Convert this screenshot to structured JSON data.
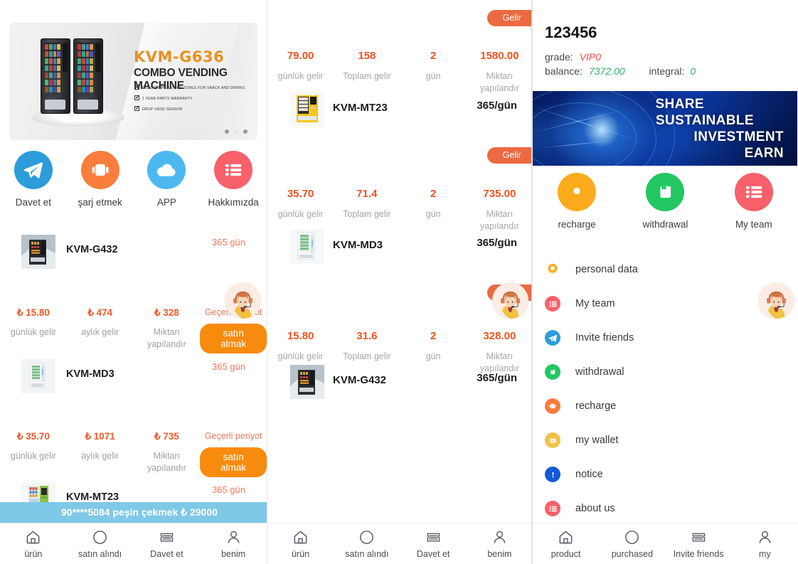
{
  "colors": {
    "orange": "#f05a28",
    "orange_badge": "#ec6941",
    "buy_button": "#f78b0e",
    "blue_notice": "#7ec8e8",
    "vip_red": "#fb4a45",
    "balance_green": "#28b463",
    "days_red": "#f0775a"
  },
  "left_panel": {
    "carousel": {
      "model": "KVM-G636",
      "title": "COMBO VENDING MACHINE",
      "features": [
        "DUAL TEMPERATURE ZONES FOR SNACK AND DRINKS",
        "1 YEAR PARTS WARRANTY",
        "DROP VEND SENSOR"
      ],
      "dots": 3,
      "active_dot": 1
    },
    "quick_actions": [
      {
        "label": "Davet et",
        "icon": "telegram-plane-icon",
        "color": "#2d9cdb"
      },
      {
        "label": "şarj etmek",
        "icon": "recharge-icon",
        "color": "#f97d3c"
      },
      {
        "label": "APP",
        "icon": "cloud-icon",
        "color": "#4db8f0"
      },
      {
        "label": "Hakkımızda",
        "icon": "list-icon",
        "color": "#f8606a"
      }
    ],
    "products": [
      {
        "name": "KVM-G432",
        "days": "365 gün",
        "thumb": "vending-machine-dark",
        "stats": [
          {
            "value": "₺ 15.80",
            "label": "günlük gelir"
          },
          {
            "value": "₺ 474",
            "label": "aylık gelir"
          },
          {
            "value": "₺ 328",
            "label": "Miktarı yapılandır"
          }
        ],
        "period_label": "Geçerli periyot",
        "buy_label": "satın almak"
      },
      {
        "name": "KVM-MD3",
        "days": "365 gün",
        "thumb": "vending-machine-white",
        "stats": [
          {
            "value": "₺ 35.70",
            "label": "günlük gelir"
          },
          {
            "value": "₺ 1071",
            "label": "aylık gelir"
          },
          {
            "value": "₺ 735",
            "label": "Miktarı yapılandır"
          }
        ],
        "period_label": "Geçerli periyot",
        "buy_label": "satın almak"
      },
      {
        "name": "KVM-MT23",
        "days": "365 gün",
        "thumb": "vending-machine-green"
      }
    ],
    "notice": "90****5084 peşin çekmek ₺ 29000",
    "tabbar": [
      {
        "label": "ürün",
        "icon": "home-icon"
      },
      {
        "label": "satın alındı",
        "icon": "circle-icon"
      },
      {
        "label": "Davet et",
        "icon": "ticket-icon"
      },
      {
        "label": "benim",
        "icon": "user-icon"
      }
    ]
  },
  "mid_panel": {
    "blocks": [
      {
        "badge": "Gelir",
        "stats": [
          {
            "value": "79.00",
            "label": "günlük gelir"
          },
          {
            "value": "158",
            "label": "Toplam gelir"
          },
          {
            "value": "2",
            "label": "gün"
          },
          {
            "value": "1580.00",
            "label": "Miktarı yapılandır"
          }
        ],
        "product": {
          "name": "KVM-MT23",
          "rate": "365/gün",
          "thumb": "vending-machine-yellow"
        }
      },
      {
        "badge": "Gelir",
        "stats": [
          {
            "value": "35.70",
            "label": "günlük gelir"
          },
          {
            "value": "71.4",
            "label": "Toplam gelir"
          },
          {
            "value": "2",
            "label": "gün"
          },
          {
            "value": "735.00",
            "label": "Miktarı yapılandır"
          }
        ],
        "product": {
          "name": "KVM-MD3",
          "rate": "365/gün",
          "thumb": "vending-machine-white"
        }
      },
      {
        "badge": "Gelir",
        "stats": [
          {
            "value": "15.80",
            "label": "günlük gelir"
          },
          {
            "value": "31.6",
            "label": "Toplam gelir"
          },
          {
            "value": "2",
            "label": "gün"
          },
          {
            "value": "328.00",
            "label": "Miktarı yapılandır"
          }
        ],
        "product": {
          "name": "KVM-G432",
          "rate": "365/gün",
          "thumb": "vending-machine-dark"
        }
      }
    ],
    "tabbar": [
      {
        "label": "ürün",
        "icon": "home-icon"
      },
      {
        "label": "satın alındı",
        "icon": "circle-icon"
      },
      {
        "label": "Davet et",
        "icon": "ticket-icon"
      },
      {
        "label": "benim",
        "icon": "user-icon"
      }
    ]
  },
  "right_panel": {
    "user": {
      "id": "123456",
      "grade_label": "grade:",
      "grade_value": "VIP0",
      "balance_label": "balance:",
      "balance_value": "7372.00",
      "integral_label": "integral:",
      "integral_value": "0"
    },
    "banner": {
      "line1": "SHARE",
      "line2": "SUSTAINABLE",
      "line3": "INVESTMENT",
      "line4": "EARN"
    },
    "quick_actions": [
      {
        "label": "recharge",
        "icon": "gear-icon",
        "color": "#fbab1b"
      },
      {
        "label": "withdrawal",
        "icon": "withdraw-icon",
        "color": "#22c761"
      },
      {
        "label": "My team",
        "icon": "list-icon",
        "color": "#f8606a"
      }
    ],
    "menu": [
      {
        "label": "personal data",
        "icon": "gear-icon",
        "color": "#fbab1b"
      },
      {
        "label": "My team",
        "icon": "list-icon",
        "color": "#f8606a"
      },
      {
        "label": "Invite friends",
        "icon": "telegram-plane-icon",
        "color": "#2d9cdb"
      },
      {
        "label": "withdrawal",
        "icon": "withdraw-icon",
        "color": "#22c761"
      },
      {
        "label": "recharge",
        "icon": "recharge-icon",
        "color": "#f97d3c"
      },
      {
        "label": "my wallet",
        "icon": "wallet-icon",
        "color": "#f2c14b"
      },
      {
        "label": "notice",
        "icon": "notice-icon",
        "color": "#1358d6"
      },
      {
        "label": "about us",
        "icon": "list-icon",
        "color": "#f8606a"
      }
    ],
    "tabbar": [
      {
        "label": "product",
        "icon": "home-icon"
      },
      {
        "label": "purchased",
        "icon": "circle-icon"
      },
      {
        "label": "Invite friends",
        "icon": "ticket-icon"
      },
      {
        "label": "my",
        "icon": "user-icon"
      }
    ]
  },
  "service_widget": {
    "name": "customer-service-avatar"
  }
}
